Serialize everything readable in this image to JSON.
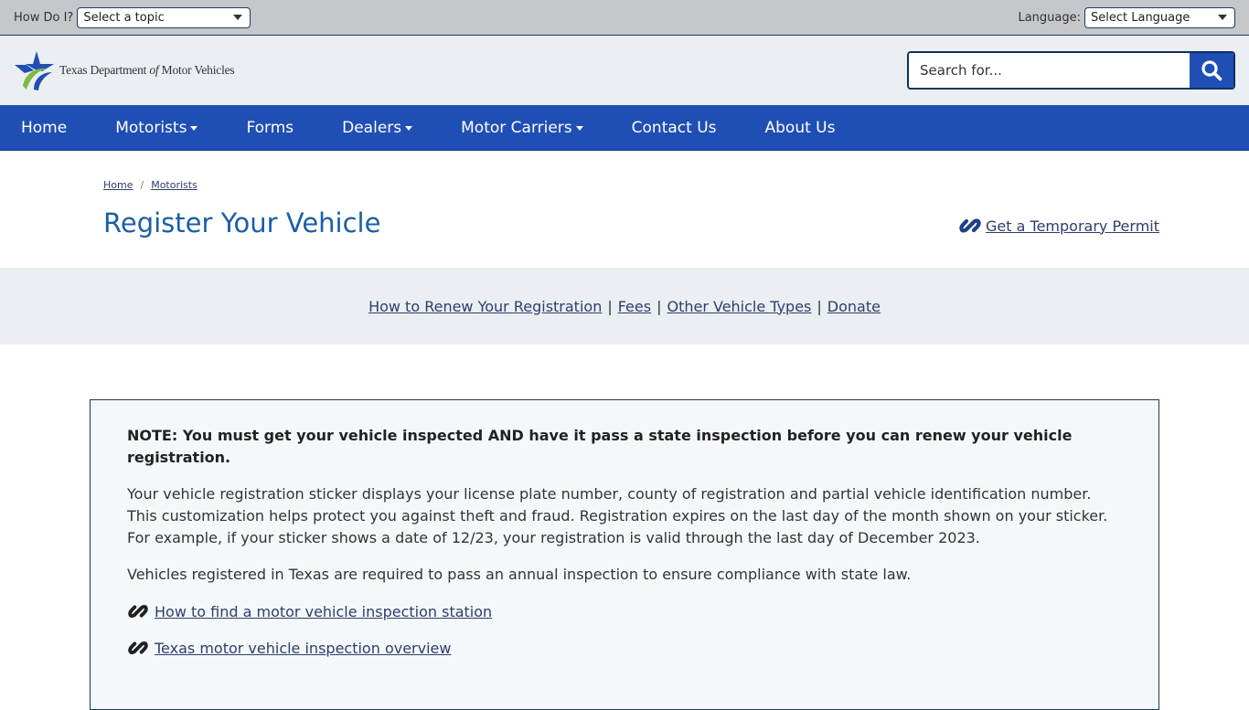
{
  "utility": {
    "how_do_i_label": "How Do I?",
    "topic_select_value": "Select a topic",
    "language_label": "Language:",
    "language_select_value": "Select Language"
  },
  "header": {
    "logo_text_pre": "Texas Department ",
    "logo_text_of": "of",
    "logo_text_post": " Motor Vehicles",
    "search_placeholder": "Search for...",
    "search_icon": "search-icon"
  },
  "nav": {
    "items": [
      {
        "label": "Home",
        "dropdown": false
      },
      {
        "label": "Motorists",
        "dropdown": true
      },
      {
        "label": "Forms",
        "dropdown": false
      },
      {
        "label": "Dealers",
        "dropdown": true
      },
      {
        "label": "Motor Carriers",
        "dropdown": true
      },
      {
        "label": "Contact Us",
        "dropdown": false
      },
      {
        "label": "About Us",
        "dropdown": false
      }
    ]
  },
  "breadcrumb": {
    "items": [
      "Home",
      "Motorists"
    ],
    "separator": "/"
  },
  "page": {
    "title": "Register Your Vehicle",
    "temp_permit_label": " Get a Temporary Permit"
  },
  "subnav": {
    "links": [
      "How to Renew Your Registration",
      "Fees",
      "Other Vehicle Types",
      "Donate"
    ],
    "separator": "|"
  },
  "notice": {
    "strong": "NOTE: You must get your vehicle inspected AND have it pass a state inspection before you can renew your vehicle registration.",
    "paragraph1": "Your vehicle registration sticker displays your license plate number, county of registration and partial vehicle identification number. This customization helps protect you against theft and fraud. Registration expires on the last day of the month shown on your sticker. For example, if your sticker shows a date of 12/23, your registration is valid through the last day of December 2023.",
    "paragraph2": "Vehicles registered in Texas are required to pass an annual inspection to ensure compliance with state law.",
    "links": [
      "How to find a motor vehicle inspection station",
      "Texas motor vehicle inspection overview"
    ]
  },
  "colors": {
    "nav_blue": "#1f4fb5",
    "title_blue": "#1b5fa6",
    "link_color": "#2d3e6b",
    "utility_gray": "#c5c7ca",
    "band_gray": "#ebeef2"
  }
}
